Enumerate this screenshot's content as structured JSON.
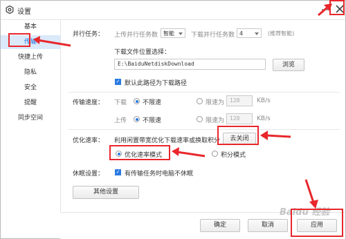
{
  "title": "设置",
  "sidebar": {
    "items": [
      {
        "label": "基本"
      },
      {
        "label": "传输"
      },
      {
        "label": "快捷上传"
      },
      {
        "label": "隐私"
      },
      {
        "label": "安全"
      },
      {
        "label": "提醒"
      },
      {
        "label": "同步空间"
      }
    ],
    "active_index": 1
  },
  "transfer": {
    "parallel_label": "并行任务：",
    "upload_parallel_label": "上传并行任务数",
    "upload_parallel_value": "智能",
    "download_parallel_label": "下载并行任务数",
    "download_parallel_value": "4",
    "recommend_hint": "(推荐智能)",
    "download_location_label": "下载文件位置选择：",
    "download_path": "E:\\BaiduNetdiskDownload",
    "browse_label": "浏览",
    "default_path_label": "默认此路径为下载路径",
    "default_path_checked": true
  },
  "speed": {
    "label": "传输速度：",
    "download_label": "下载",
    "upload_label": "上传",
    "unlimited_label": "不限速",
    "limit_label": "限速为",
    "download_limit_value": "128",
    "upload_limit_value": "128",
    "unit": "KB/s"
  },
  "optimize": {
    "label": "优化速率：",
    "description": "利用闲置带宽优化下载速率或换取积分",
    "close_button": "去关闭",
    "mode_speed": "优化速率模式",
    "mode_points": "积分模式"
  },
  "sleep": {
    "label": "休眠设置：",
    "option": "有传输任务时电脑不休眠",
    "checked": true
  },
  "other_settings_label": "其他设置",
  "footer": {
    "ok": "确定",
    "cancel": "取消",
    "apply": "应用"
  },
  "watermark": "Baidu 经验",
  "colors": {
    "annotation_red": "#e8262b",
    "accent_blue": "#2a7ae2",
    "active_bg": "#dbe9fb"
  }
}
